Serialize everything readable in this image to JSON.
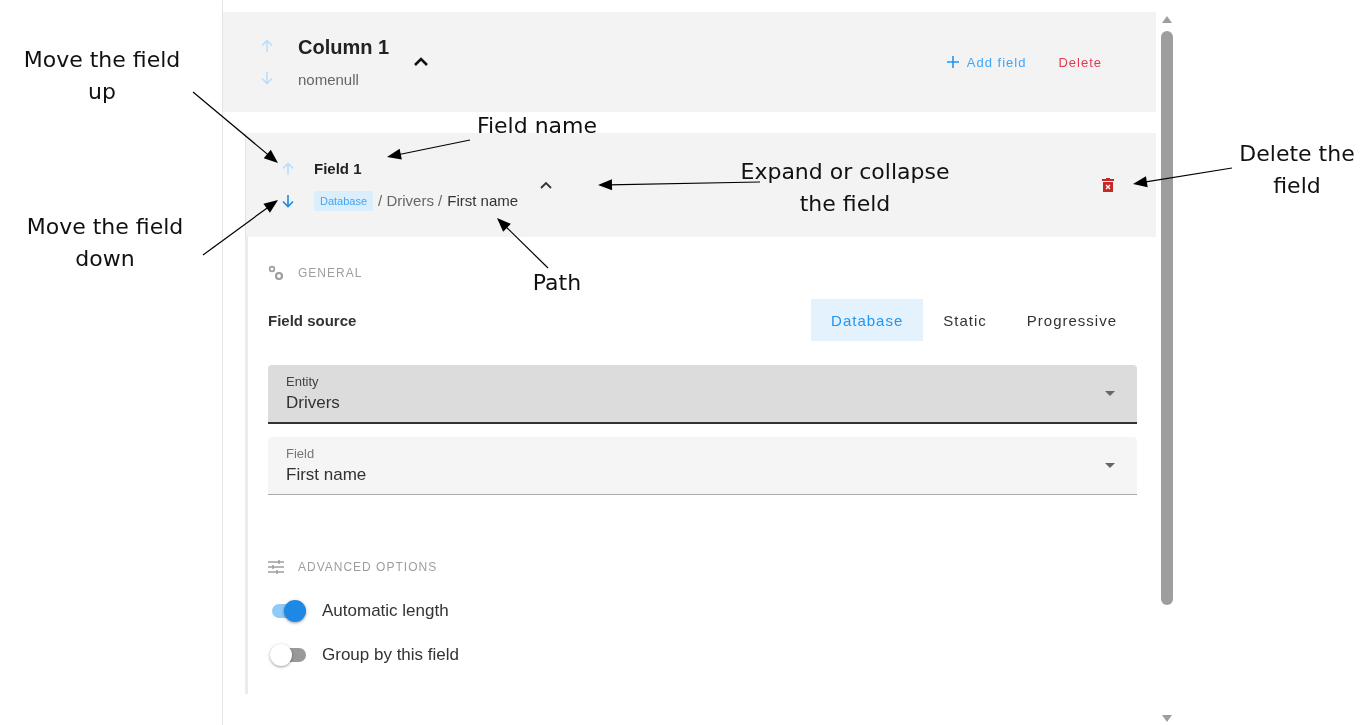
{
  "column": {
    "title": "Column 1",
    "subtitle": "nomenull",
    "move_up_disabled": true,
    "move_down_disabled": true,
    "expanded": true,
    "add_label": "Add field",
    "delete_label": "Delete"
  },
  "field": {
    "name": "Field 1",
    "move_up_disabled": true,
    "move_down_disabled": false,
    "expanded": true,
    "source_badge": "Database",
    "path": [
      {
        "text": "/ Drivers /"
      },
      {
        "text": "First name"
      }
    ]
  },
  "general": {
    "title": "GENERAL",
    "source_label": "Field source",
    "source_options": [
      {
        "label": "Database",
        "selected": true
      },
      {
        "label": "Static",
        "selected": false
      },
      {
        "label": "Progressive",
        "selected": false
      }
    ],
    "selects": [
      {
        "label": "Entity",
        "value": "Drivers",
        "focused": true
      },
      {
        "label": "Field",
        "value": "First name",
        "focused": false
      }
    ]
  },
  "advanced": {
    "title": "ADVANCED OPTIONS",
    "toggles": [
      {
        "label": "Automatic length",
        "on": true
      },
      {
        "label": "Group by this field",
        "on": false
      }
    ]
  },
  "annotations": [
    {
      "text": "Move the field up"
    },
    {
      "text": "Move the field down"
    },
    {
      "text": "Field name"
    },
    {
      "text": "Expand or collapse the field"
    },
    {
      "text": "Path"
    },
    {
      "text": "Delete the field"
    }
  ]
}
